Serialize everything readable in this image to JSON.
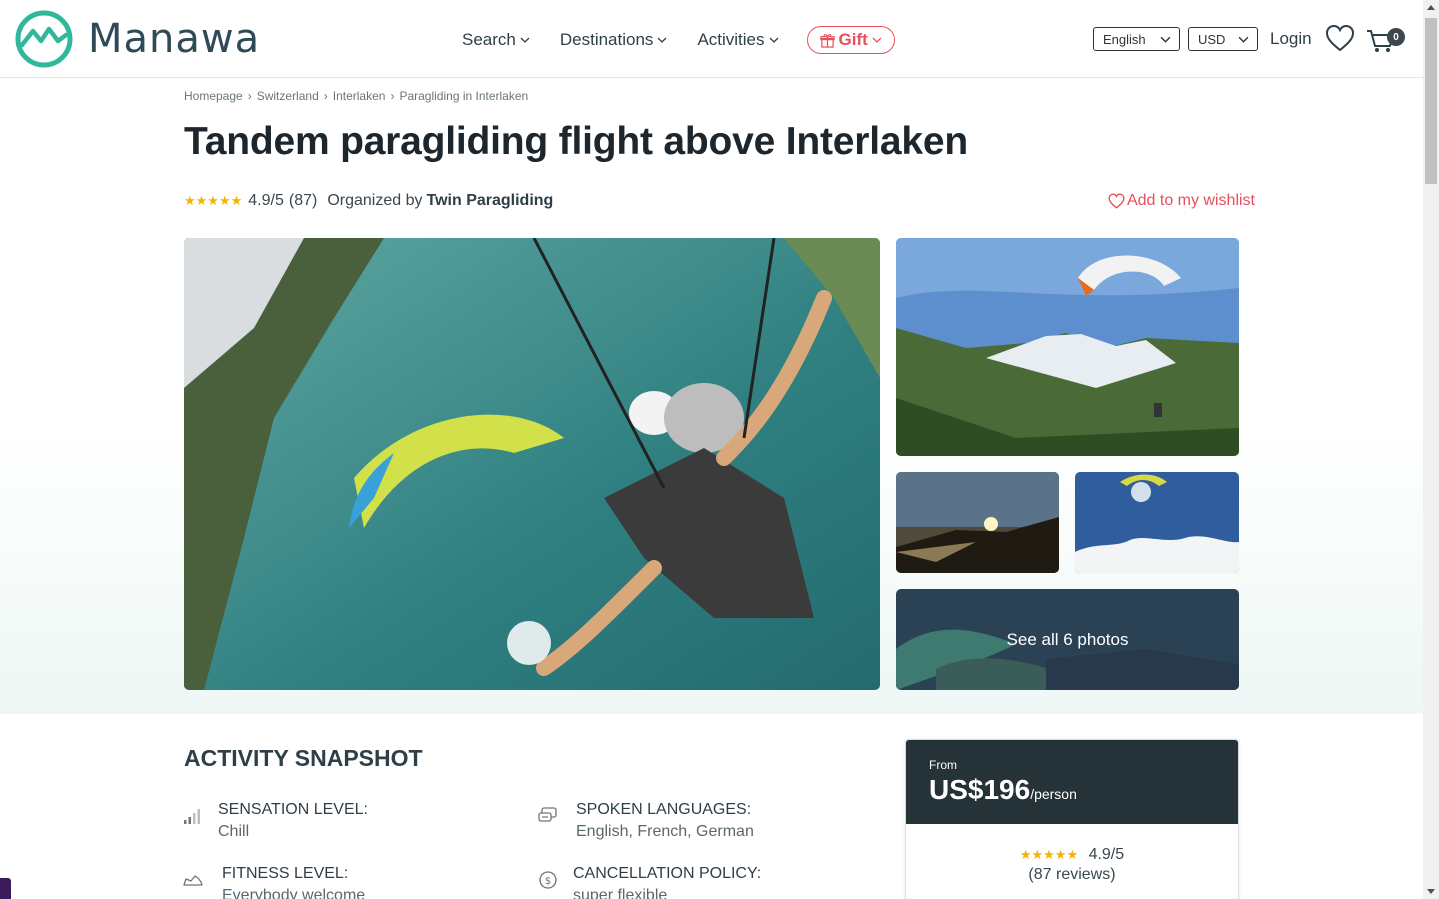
{
  "brand": {
    "name": "Manawa",
    "color": "#2fb89b"
  },
  "nav": {
    "items": [
      "Search",
      "Destinations",
      "Activities"
    ],
    "gift_label": "Gift",
    "language": "English",
    "currency": "USD",
    "login": "Login",
    "cart_count": "0"
  },
  "breadcrumb": [
    "Homepage",
    "Switzerland",
    "Interlaken",
    "Paragliding in Interlaken"
  ],
  "title": "Tandem paragliding flight above Interlaken",
  "rating": {
    "stars": "★★★★★",
    "score": "4.9/5",
    "count": "(87)",
    "organized_prefix": "Organized by",
    "organizer": "Twin Paragliding"
  },
  "wishlist_label": "Add to my wishlist",
  "gallery": {
    "see_all": "See all 6 photos"
  },
  "snapshot": {
    "title": "ACTIVITY SNAPSHOT",
    "features": [
      {
        "label": "SENSATION LEVEL:",
        "value": "Chill",
        "icon": "signal-bars-icon"
      },
      {
        "label": "SPOKEN LANGUAGES:",
        "value": "English, French, German",
        "icon": "chat-bubbles-icon"
      },
      {
        "label": "FITNESS LEVEL:",
        "value": "Everybody welcome",
        "icon": "shoe-icon"
      },
      {
        "label": "CANCELLATION POLICY:",
        "value": "super flexible",
        "icon": "dollar-circle-icon"
      }
    ]
  },
  "price": {
    "from": "From",
    "amount": "US$196",
    "unit": "/person",
    "stars": "★★★★★",
    "score": "4.9/5",
    "reviews": "(87 reviews)"
  },
  "colors": {
    "accent": "#e84f5b",
    "dark": "#253238",
    "star": "#f4b400"
  }
}
